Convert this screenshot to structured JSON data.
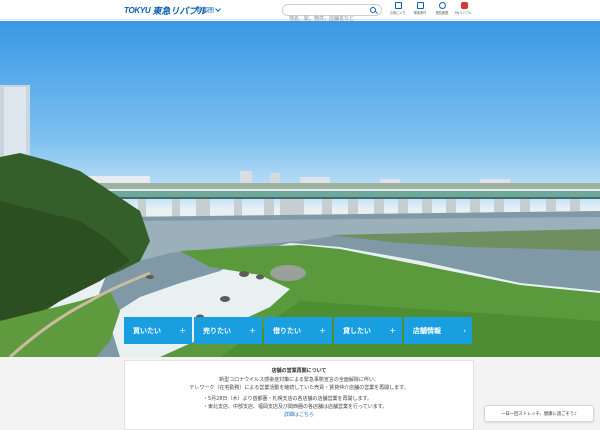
{
  "header": {
    "logo_mark": "TOKYU",
    "logo_text": "東急リバブル",
    "region": "首都圏",
    "search_placeholder": "地名、駅、物件、店舗名など",
    "nav": [
      {
        "label": "お気に入り",
        "icon": "heart-list-icon"
      },
      {
        "label": "検索条件",
        "icon": "search-condition-icon"
      },
      {
        "label": "閲覧履歴",
        "icon": "history-icon"
      },
      {
        "label": "Myリバブル",
        "icon": "my-livable-icon"
      }
    ]
  },
  "actions": [
    {
      "label": "買いたい",
      "icon": "plus"
    },
    {
      "label": "売りたい",
      "icon": "plus"
    },
    {
      "label": "借りたい",
      "icon": "plus"
    },
    {
      "label": "貸したい",
      "icon": "plus"
    },
    {
      "label": "店舗情報",
      "icon": "chevron"
    }
  ],
  "notice": {
    "title": "店舗の営業再開について",
    "line1": "新型コロナウイルス感染症対策による緊急事態宣言の全面解除に伴い、",
    "line2": "テレワーク（在宅勤務）による営業活動を継続していた売買・賃貸仲介店舗の営業を再開します。",
    "item1": "・5月28日（木）より首都圏・札幌支店の各店舗の店舗営業を再開します。",
    "item2": "・東北支店、中部支店、福岡支店及び関西圏の各店舗は店舗営業を行っています。",
    "link": "詳細はこちら"
  },
  "chat": {
    "text": "一日一回ストレッチ、健康に過ごそう♪"
  },
  "colors": {
    "brand": "#0a5fb4",
    "action": "#199ee0"
  }
}
